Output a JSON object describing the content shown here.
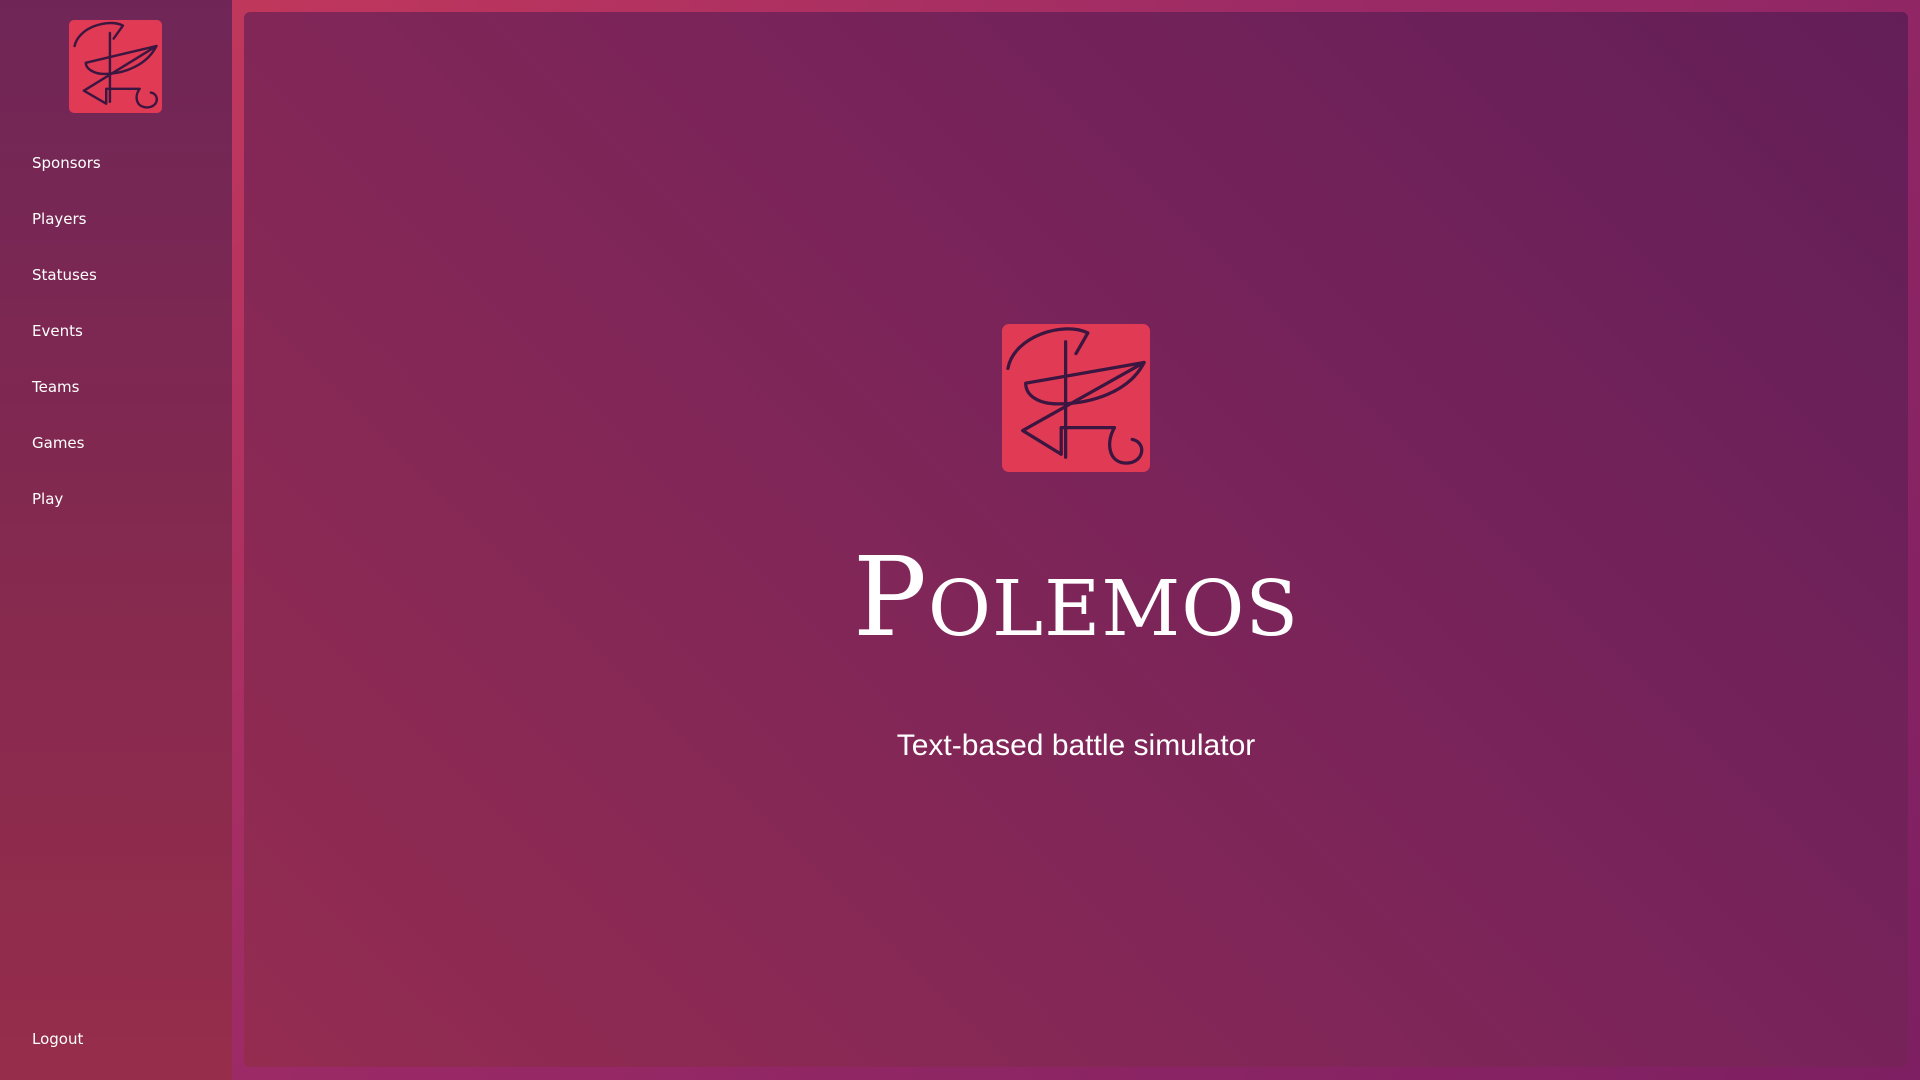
{
  "app": {
    "name": "Polemos",
    "subtitle": "Text-based battle simulator"
  },
  "sidebar": {
    "logo_icon": "polemos-sigil-icon",
    "items": [
      {
        "label": "Sponsors"
      },
      {
        "label": "Players"
      },
      {
        "label": "Statuses"
      },
      {
        "label": "Events"
      },
      {
        "label": "Teams"
      },
      {
        "label": "Games"
      },
      {
        "label": "Play"
      }
    ],
    "logout_label": "Logout"
  },
  "colors": {
    "logo_background": "#e03a55",
    "logo_stroke": "#3a1640",
    "text": "#ffffff"
  }
}
